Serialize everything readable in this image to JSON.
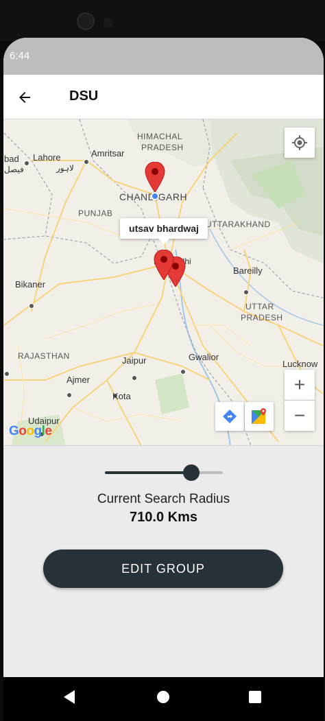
{
  "status_bar": {
    "time": "6:44"
  },
  "app_bar": {
    "title": "DSU",
    "back_icon": "arrow-left-icon"
  },
  "map": {
    "labels": {
      "lahore": "Lahore",
      "lahore_urdu": "لاہور",
      "abad": "bad",
      "abad_urdu": "فیصل",
      "amritsar": "Amritsar",
      "himachal": "HIMACHAL",
      "pradesh1": "PRADESH",
      "chandigarh": "CHANDIGARH",
      "punjab": "PUNJAB",
      "uttarakhand": "UTTARAKHAND",
      "bikaner": "Bikaner",
      "bareilly": "Bareilly",
      "uttar": "UTTAR",
      "pradesh2": "PRADESH",
      "rajasthan": "RAJASTHAN",
      "jaipur": "Jaipur",
      "gwalior": "Gwalior",
      "lucknow": "Lucknow",
      "ajmer": "Ajmer",
      "kota": "Kota",
      "udaipur": "Udaipur",
      "delhi": "New Delhi"
    },
    "info_window": "utsav bhardwaj",
    "zoom_in": "+",
    "zoom_out": "−",
    "google_letters": [
      "G",
      "o",
      "o",
      "g",
      "l",
      "e"
    ],
    "google_colors": [
      "#4285f4",
      "#ea4335",
      "#fbbc05",
      "#4285f4",
      "#34a853",
      "#ea4335"
    ]
  },
  "slider": {
    "value_fraction": 0.73
  },
  "radius": {
    "label": "Current Search Radius",
    "value": "710.0 Kms"
  },
  "edit_button": {
    "label": "EDIT GROUP"
  },
  "colors": {
    "primary": "#263238",
    "pin": "#e53935",
    "user_dot": "#4285f4"
  }
}
